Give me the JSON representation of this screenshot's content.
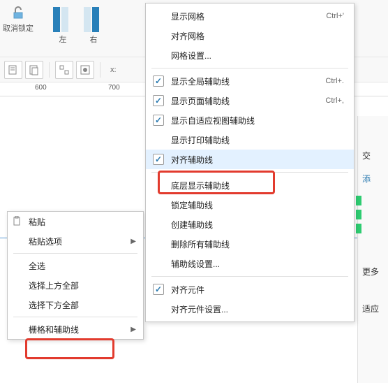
{
  "toolbar": {
    "unlock_label": "取消锁定",
    "left_label": "左",
    "right_label": "右",
    "x_label": "x:"
  },
  "ruler": {
    "tick600": "600",
    "tick700": "700"
  },
  "context_menu": {
    "paste": "粘贴",
    "paste_options": "粘贴选项",
    "select_all": "全选",
    "select_above": "选择上方全部",
    "select_below": "选择下方全部",
    "grid_guides": "栅格和辅助线"
  },
  "submenu": {
    "items": [
      {
        "label": "显示网格",
        "shortcut": "Ctrl+'",
        "checked": false
      },
      {
        "label": "对齐网格",
        "shortcut": "",
        "checked": false
      },
      {
        "label": "网格设置...",
        "shortcut": "",
        "checked": false
      }
    ],
    "items2": [
      {
        "label": "显示全局辅助线",
        "shortcut": "Ctrl+.",
        "checked": true
      },
      {
        "label": "显示页面辅助线",
        "shortcut": "Ctrl+,",
        "checked": true
      },
      {
        "label": "显示自适应视图辅助线",
        "shortcut": "",
        "checked": true
      },
      {
        "label": "显示打印辅助线",
        "shortcut": "",
        "checked": false
      },
      {
        "label": "对齐辅助线",
        "shortcut": "",
        "checked": true
      }
    ],
    "items3": [
      {
        "label": "底层显示辅助线",
        "shortcut": "",
        "checked": false
      },
      {
        "label": "锁定辅助线",
        "shortcut": "",
        "checked": false
      },
      {
        "label": "创建辅助线",
        "shortcut": "",
        "checked": false
      },
      {
        "label": "删除所有辅助线",
        "shortcut": "",
        "checked": false
      },
      {
        "label": "辅助线设置...",
        "shortcut": "",
        "checked": false
      }
    ],
    "items4": [
      {
        "label": "对齐元件",
        "shortcut": "",
        "checked": true
      },
      {
        "label": "对齐元件设置...",
        "shortcut": "",
        "checked": false
      }
    ]
  },
  "right_panel": {
    "interact": "交",
    "link": "添",
    "more": "更多",
    "adapt": "适应"
  }
}
